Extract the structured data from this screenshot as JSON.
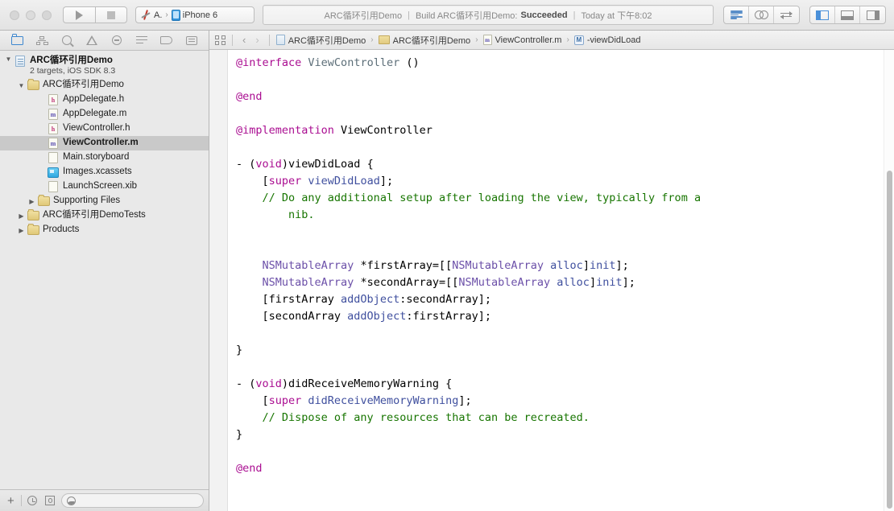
{
  "window": {
    "traffic_lights": [
      "close",
      "minimize",
      "zoom"
    ]
  },
  "toolbar": {
    "run_label": "Run",
    "stop_label": "Stop",
    "scheme": {
      "scheme_name": "A.",
      "separator": "›",
      "destination": "iPhone 6"
    },
    "status": {
      "project": "ARC循环引用Demo",
      "sep1": "|",
      "action": "Build ARC循环引用Demo:",
      "result": "Succeeded",
      "sep2": "|",
      "time": "Today at 下午8:02"
    },
    "editor_modes": [
      {
        "name": "standard-editor",
        "icon": "lines-icon",
        "active": true
      },
      {
        "name": "assistant-editor",
        "icon": "venn-icon",
        "active": false
      },
      {
        "name": "version-editor",
        "icon": "two-arrows-icon",
        "active": false
      }
    ],
    "view_toggles": [
      {
        "name": "navigator-toggle",
        "icon": "left-panel-icon",
        "active": true
      },
      {
        "name": "debug-area-toggle",
        "icon": "bottom-panel-icon",
        "active": false
      },
      {
        "name": "utilities-toggle",
        "icon": "right-panel-icon",
        "active": false
      }
    ]
  },
  "navigator": {
    "tabs": [
      {
        "name": "project-navigator",
        "icon": "folder-icon",
        "active": true
      },
      {
        "name": "symbol-navigator",
        "icon": "hierarchy-icon",
        "active": false
      },
      {
        "name": "find-navigator",
        "icon": "search-icon",
        "active": false
      },
      {
        "name": "issue-navigator",
        "icon": "warning-triangle-icon",
        "active": false
      },
      {
        "name": "test-navigator",
        "icon": "minus-circle-icon",
        "active": false
      },
      {
        "name": "debug-navigator",
        "icon": "list-icon",
        "active": false
      },
      {
        "name": "breakpoint-navigator",
        "icon": "tag-icon",
        "active": false
      },
      {
        "name": "report-navigator",
        "icon": "speech-bubble-icon",
        "active": false
      }
    ],
    "project": {
      "title": "ARC循环引用Demo",
      "subtitle": "2 targets, iOS SDK 8.3"
    },
    "tree": [
      {
        "label": "ARC循环引用Demo",
        "type": "folder",
        "depth": 1,
        "twisty": "open",
        "selected": false
      },
      {
        "label": "AppDelegate.h",
        "type": "file-h",
        "depth": 2,
        "twisty": "empty",
        "selected": false
      },
      {
        "label": "AppDelegate.m",
        "type": "file-m",
        "depth": 2,
        "twisty": "empty",
        "selected": false
      },
      {
        "label": "ViewController.h",
        "type": "file-h",
        "depth": 2,
        "twisty": "empty",
        "selected": false
      },
      {
        "label": "ViewController.m",
        "type": "file-m",
        "depth": 2,
        "twisty": "empty",
        "selected": true
      },
      {
        "label": "Main.storyboard",
        "type": "file-sb",
        "depth": 2,
        "twisty": "empty",
        "selected": false
      },
      {
        "label": "Images.xcassets",
        "type": "xcassets",
        "depth": 2,
        "twisty": "empty",
        "selected": false
      },
      {
        "label": "LaunchScreen.xib",
        "type": "file-xib",
        "depth": 2,
        "twisty": "empty",
        "selected": false
      },
      {
        "label": "Supporting Files",
        "type": "folder",
        "depth": 2,
        "twisty": "closed",
        "selected": false
      },
      {
        "label": "ARC循环引用DemoTests",
        "type": "folder",
        "depth": 1,
        "twisty": "closed",
        "selected": false
      },
      {
        "label": "Products",
        "type": "folder",
        "depth": 1,
        "twisty": "closed",
        "selected": false
      }
    ],
    "bottom_bar": {
      "add_label": "+",
      "recent_icon": "clock-icon",
      "filter_icon": "filter-square-icon",
      "filter_placeholder": "",
      "filter_value": ""
    }
  },
  "jumpbar": {
    "related_items_icon": "related-items-icon",
    "back_arrow": "‹",
    "forward_arrow": "›",
    "breadcrumbs": [
      {
        "label": "ARC循环引用Demo",
        "icon": "project-icon"
      },
      {
        "label": "ARC循环引用Demo",
        "icon": "folder-icon"
      },
      {
        "label": "ViewController.m",
        "icon": "m-file-icon"
      },
      {
        "label": "-viewDidLoad",
        "icon": "method-icon"
      }
    ],
    "separator": "›"
  },
  "editor": {
    "filename": "ViewController.m",
    "language": "objective-c",
    "colors": {
      "keyword": "#aa0d91",
      "comment": "#177500",
      "class_name": "#5c6e78",
      "foundation_class": "#6b4fa8",
      "method_name": "#3f4f9e",
      "plain": "#000000",
      "background": "#ffffff"
    },
    "code_lines": [
      "",
      "@interface ViewController ()",
      "",
      "@end",
      "",
      "@implementation ViewController",
      "",
      "- (void)viewDidLoad {",
      "    [super viewDidLoad];",
      "    // Do any additional setup after loading the view, typically from a",
      "        nib.",
      "",
      "",
      "    NSMutableArray *firstArray=[[NSMutableArray alloc]init];",
      "    NSMutableArray *secondArray=[[NSMutableArray alloc]init];",
      "    [firstArray addObject:secondArray];",
      "    [secondArray addObject:firstArray];",
      "",
      "}",
      "",
      "- (void)didReceiveMemoryWarning {",
      "    [super didReceiveMemoryWarning];",
      "    // Dispose of any resources that can be recreated.",
      "}",
      "",
      "@end"
    ]
  }
}
